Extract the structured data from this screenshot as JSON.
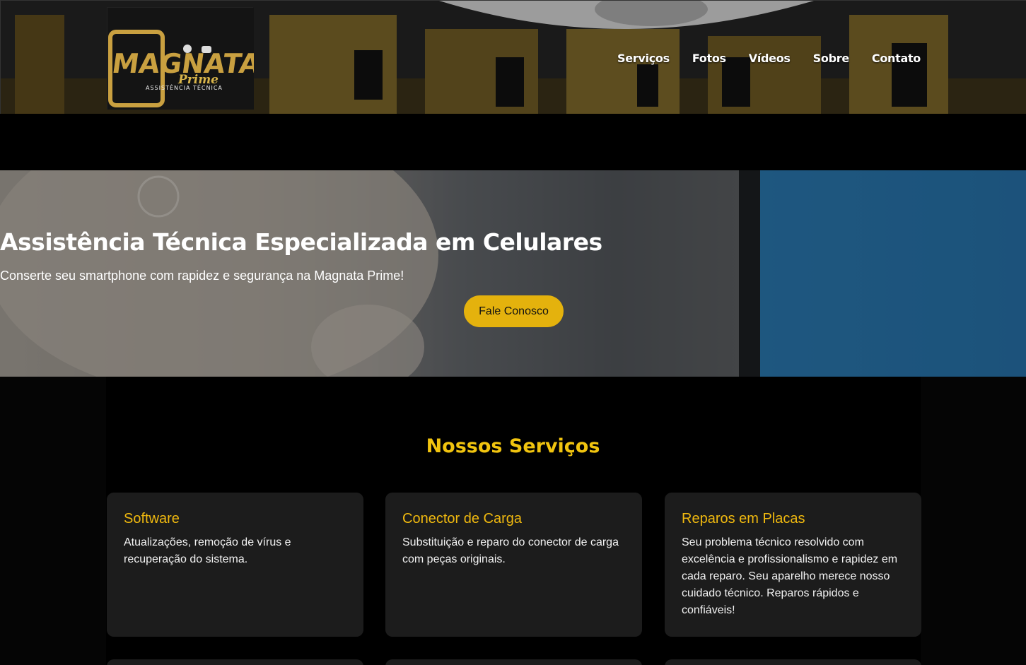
{
  "header": {
    "logo": {
      "brand": "MAGNATA",
      "tagline": "Prime",
      "subtitle": "ASSISTÊNCIA TÉCNICA"
    },
    "nav": [
      "Serviços",
      "Fotos",
      "Vídeos",
      "Sobre",
      "Contato"
    ]
  },
  "hero": {
    "title": "Assistência Técnica Especializada em Celulares",
    "subtitle": "Conserte seu smartphone com rapidez e segurança na Magnata Prime!",
    "cta": "Fale Conosco"
  },
  "services": {
    "title": "Nossos Serviços",
    "cards": [
      {
        "title": "Software",
        "text": "Atualizações, remoção de vírus e recuperação do sistema."
      },
      {
        "title": "Conector de Carga",
        "text": "Substituição e reparo do conector de carga com peças originais."
      },
      {
        "title": "Reparos em Placas",
        "text": "Seu problema técnico resolvido com excelência e profissionalismo e rapidez em cada reparo. Seu aparelho merece nosso cuidado técnico. Reparos rápidos e confiáveis!"
      }
    ]
  },
  "colors": {
    "accent": "#e4b20d",
    "heading": "#f1c40f",
    "card_bg": "#1c1c1c"
  }
}
